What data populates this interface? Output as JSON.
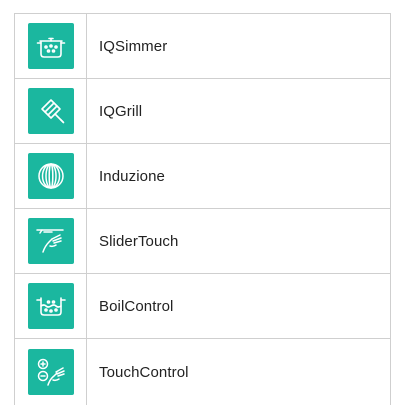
{
  "features": [
    {
      "label": "IQSimmer",
      "icon": "pot-icon"
    },
    {
      "label": "IQGrill",
      "icon": "grill-icon"
    },
    {
      "label": "Induzione",
      "icon": "induction-coil-icon"
    },
    {
      "label": "SliderTouch",
      "icon": "slider-touch-icon"
    },
    {
      "label": "BoilControl",
      "icon": "boil-control-icon"
    },
    {
      "label": "TouchControl",
      "icon": "touch-control-icon"
    }
  ],
  "colors": {
    "accent": "#1bb79f",
    "border": "#cfcfcf",
    "text": "#222222"
  }
}
